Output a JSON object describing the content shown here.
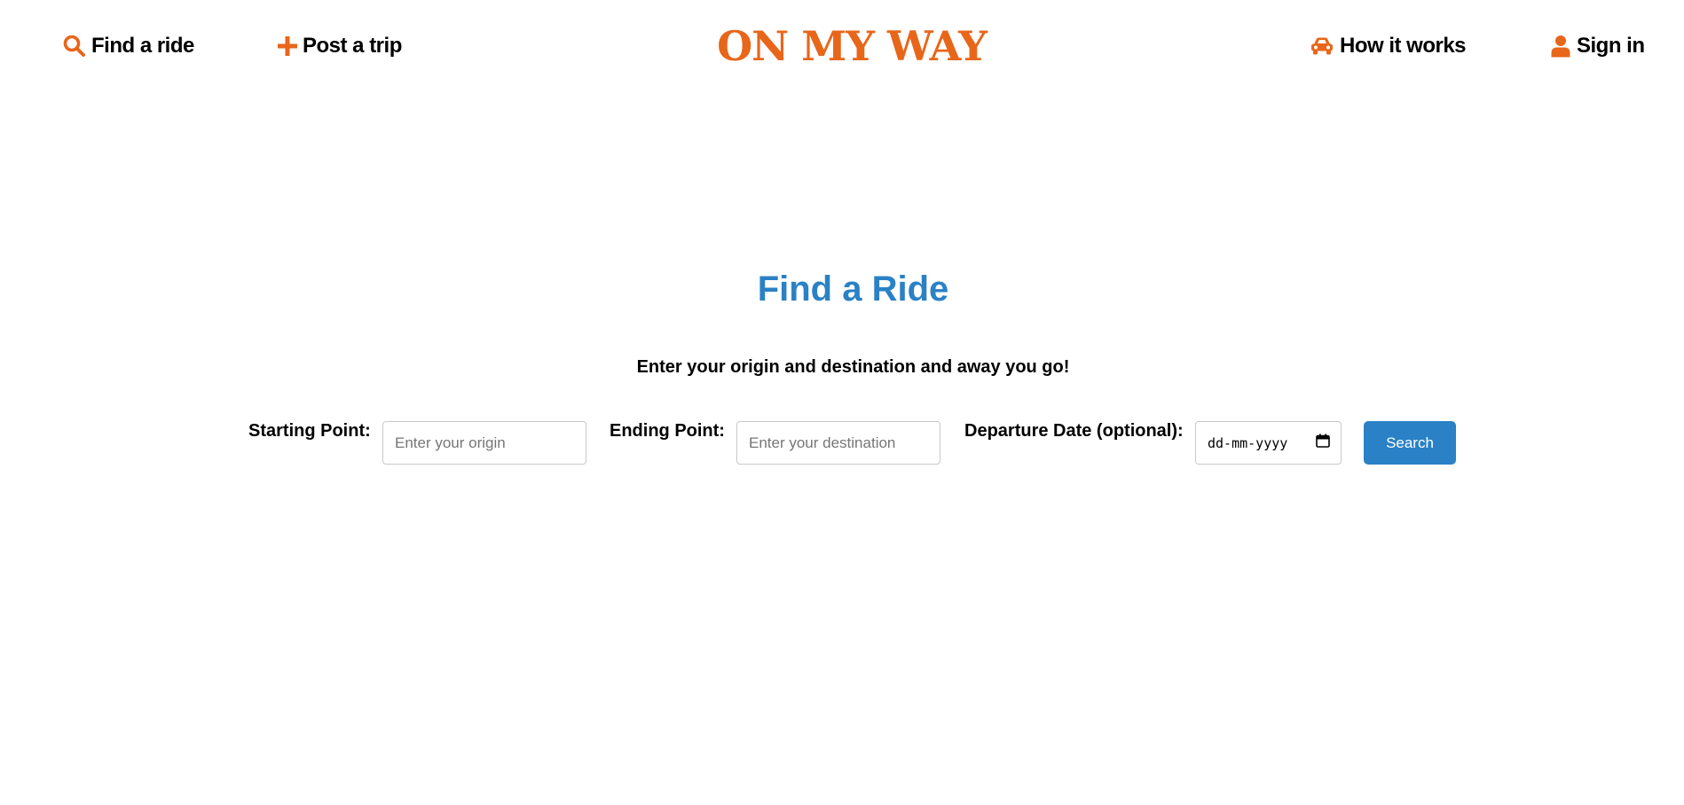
{
  "colors": {
    "brand": "#e8661a",
    "accent": "#2a81c6",
    "text": "#000000"
  },
  "header": {
    "brand": "ON MY WAY",
    "nav_left": [
      {
        "label": "Find a ride",
        "icon": "search-icon"
      },
      {
        "label": "Post a trip",
        "icon": "plus-icon"
      }
    ],
    "nav_right": [
      {
        "label": "How it works",
        "icon": "car-icon"
      },
      {
        "label": "Sign in",
        "icon": "user-icon"
      }
    ]
  },
  "main": {
    "title": "Find a Ride",
    "subtitle": "Enter your origin and destination and away you go!",
    "form": {
      "origin_label": "Starting Point:",
      "origin_placeholder": "Enter your origin",
      "destination_label": "Ending Point:",
      "destination_placeholder": "Enter your destination",
      "date_label": "Departure Date (optional):",
      "date_placeholder": "dd-mm-yyyy",
      "date_icon": "calendar-icon",
      "search_label": "Search"
    }
  }
}
